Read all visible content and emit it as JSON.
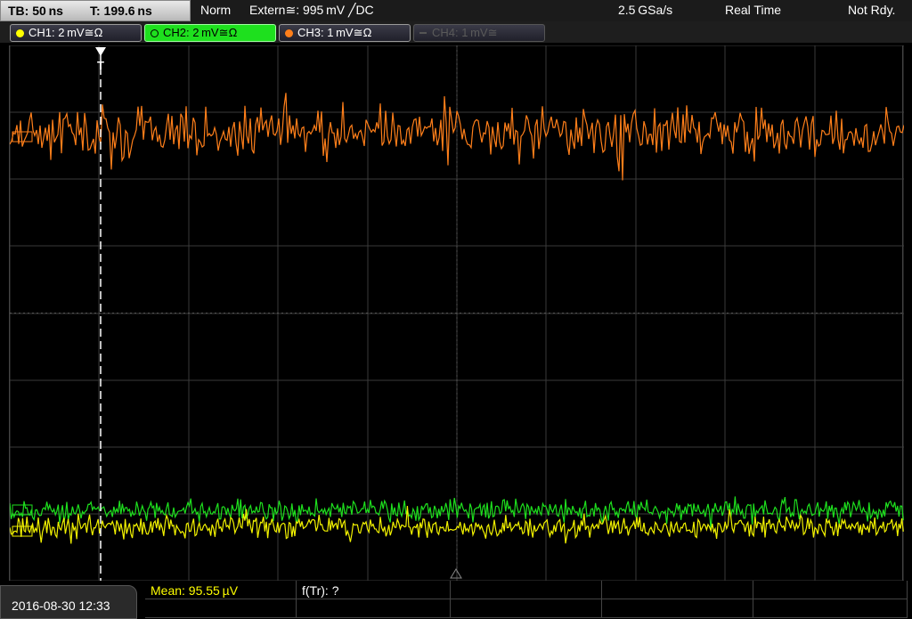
{
  "status_bar": {
    "timebase": "TB: 50 ns",
    "trigger_time": "T: 199.6 ns",
    "trigger_mode": "Norm",
    "trigger_source": "Extern≅: 995 mV ╱DC",
    "sample_rate": "2.5 GSa/s",
    "acquisition_mode": "Real Time",
    "trigger_state": "Not Rdy."
  },
  "channels": [
    {
      "label": "CH1: 2 mV≅Ω",
      "color": "#ffff00",
      "state": "on"
    },
    {
      "label": "CH2: 2 mV≅Ω",
      "color": "#00ff00",
      "state": "active"
    },
    {
      "label": "CH3: 1 mV≅Ω",
      "color": "#ff7f1a",
      "state": "on"
    },
    {
      "label": "CH4: 1 mV≅",
      "color": "#555555",
      "state": "off"
    }
  ],
  "traces": {
    "ch3_color": "#ff7f1a",
    "ch2_color": "#1ee01e",
    "ch1_color": "#f2f200",
    "grid_color": "#3a3a3a"
  },
  "footer": {
    "datetime": "2016-08-30 12:33",
    "measurement_1": "Mean: 95.55 µV",
    "measurement_2": "f(Tr): ?"
  }
}
